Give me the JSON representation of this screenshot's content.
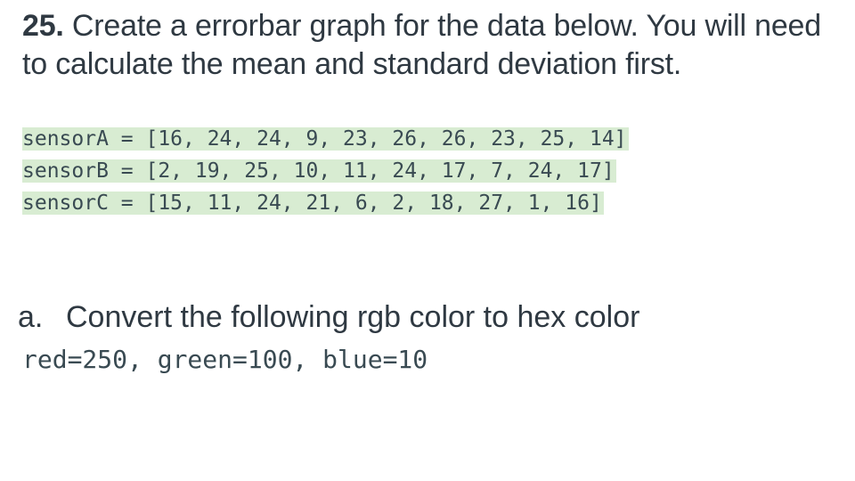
{
  "question": {
    "number": "25.",
    "text": " Create a errorbar graph for the data below. You will need to calculate the mean and standard deviation first."
  },
  "code": {
    "lines": [
      "sensorA = [16, 24, 24, 9, 23, 26, 26, 23, 25, 14]",
      "sensorB = [2, 19, 25, 10, 11, 24, 17, 7, 24, 17]",
      "sensorC = [15, 11, 24, 21, 6, 2, 18, 27, 1, 16]"
    ],
    "highlight_color": "#d8ecd2"
  },
  "subquestion": {
    "marker": "a.",
    "text": "Convert the following rgb color to hex color",
    "code": "red=250, green=100, blue=10"
  }
}
